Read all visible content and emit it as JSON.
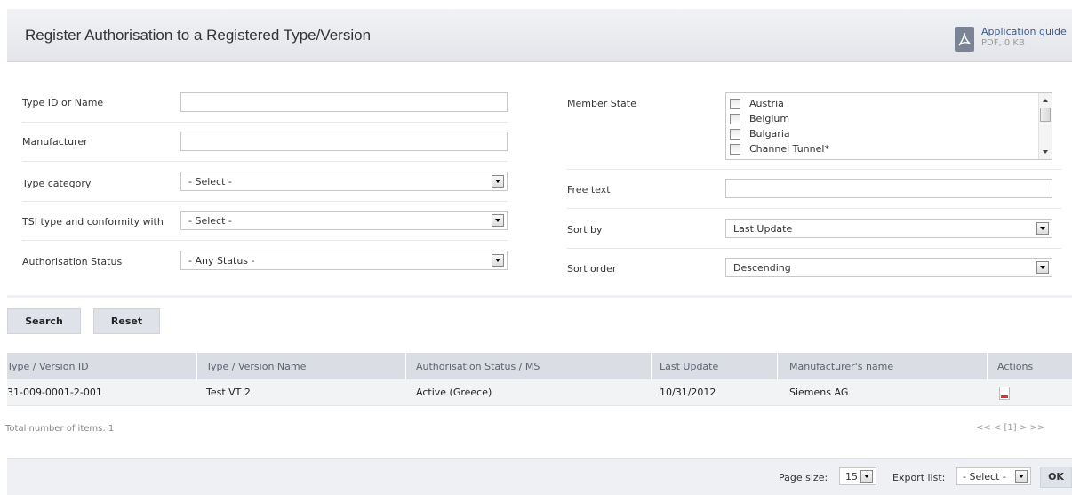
{
  "page": {
    "title": "Register Authorisation to a Registered Type/Version",
    "guide": {
      "label": "Application guide",
      "meta": "PDF, 0 KB"
    }
  },
  "form": {
    "type_id": {
      "label": "Type ID or Name",
      "value": ""
    },
    "manufacturer": {
      "label": "Manufacturer",
      "value": ""
    },
    "type_category": {
      "label": "Type category",
      "selected": "- Select -"
    },
    "tsi_type": {
      "label": "TSI type and conformity with",
      "selected": "- Select -"
    },
    "auth_status": {
      "label": "Authorisation Status",
      "selected": "- Any Status -"
    },
    "member_state": {
      "label": "Member State",
      "options": [
        "Austria",
        "Belgium",
        "Bulgaria",
        "Channel Tunnel*"
      ]
    },
    "free_text": {
      "label": "Free text",
      "value": ""
    },
    "sort_by": {
      "label": "Sort by",
      "selected": "Last Update"
    },
    "sort_order": {
      "label": "Sort order",
      "selected": "Descending"
    }
  },
  "buttons": {
    "search": "Search",
    "reset": "Reset",
    "ok": "OK"
  },
  "grid": {
    "columns": [
      "Type / Version ID",
      "Type / Version Name",
      "Authorisation Status / MS",
      "Last Update",
      "Manufacturer's name",
      "Actions"
    ],
    "rows": [
      {
        "id": "31-009-0001-2-001",
        "name": "Test VT 2",
        "status": "Active (Greece)",
        "updated": "10/31/2012",
        "manufacturer": "Siemens AG",
        "action_icon": "pdf-document-icon"
      }
    ]
  },
  "summary": {
    "total": "Total number of items: 1",
    "pager": "<< < [1] > >>"
  },
  "footer": {
    "page_size_label": "Page size:",
    "page_size": "15",
    "export_label": "Export list:",
    "export_selected": "- Select -"
  }
}
